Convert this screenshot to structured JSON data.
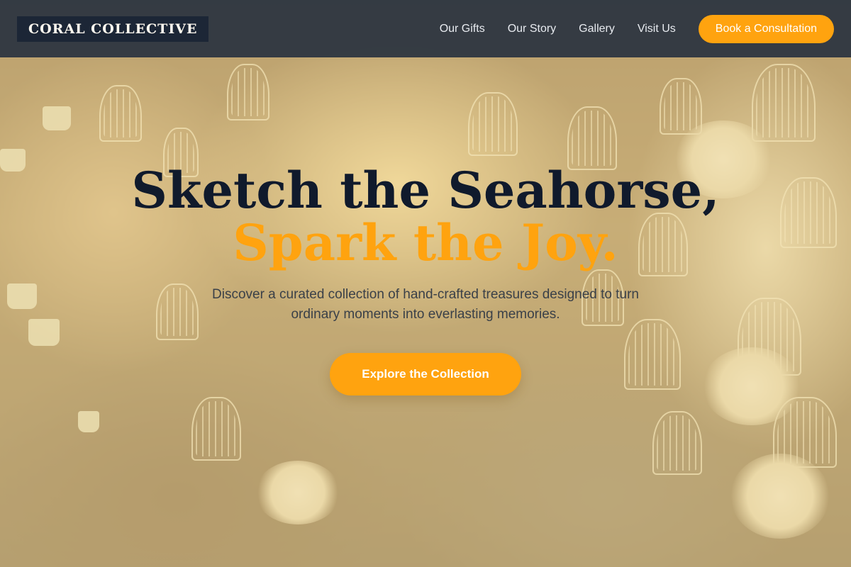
{
  "header": {
    "logo": "CORAL COLLECTIVE",
    "nav": [
      "Our Gifts",
      "Our Story",
      "Gallery",
      "Visit Us"
    ],
    "cta_label": "Book a Consultation"
  },
  "hero": {
    "headline_line1": "Sketch the Seahorse,",
    "headline_line2": "Spark the Joy.",
    "subtitle": "Discover a curated collection of hand-crafted treasures designed to turn ordinary moments into everlasting memories.",
    "button_label": "Explore the Collection"
  },
  "colors": {
    "accent": "#ffa30f",
    "header_bg": "#26303e",
    "headline": "#101a2c",
    "overlay": "#eed796"
  }
}
